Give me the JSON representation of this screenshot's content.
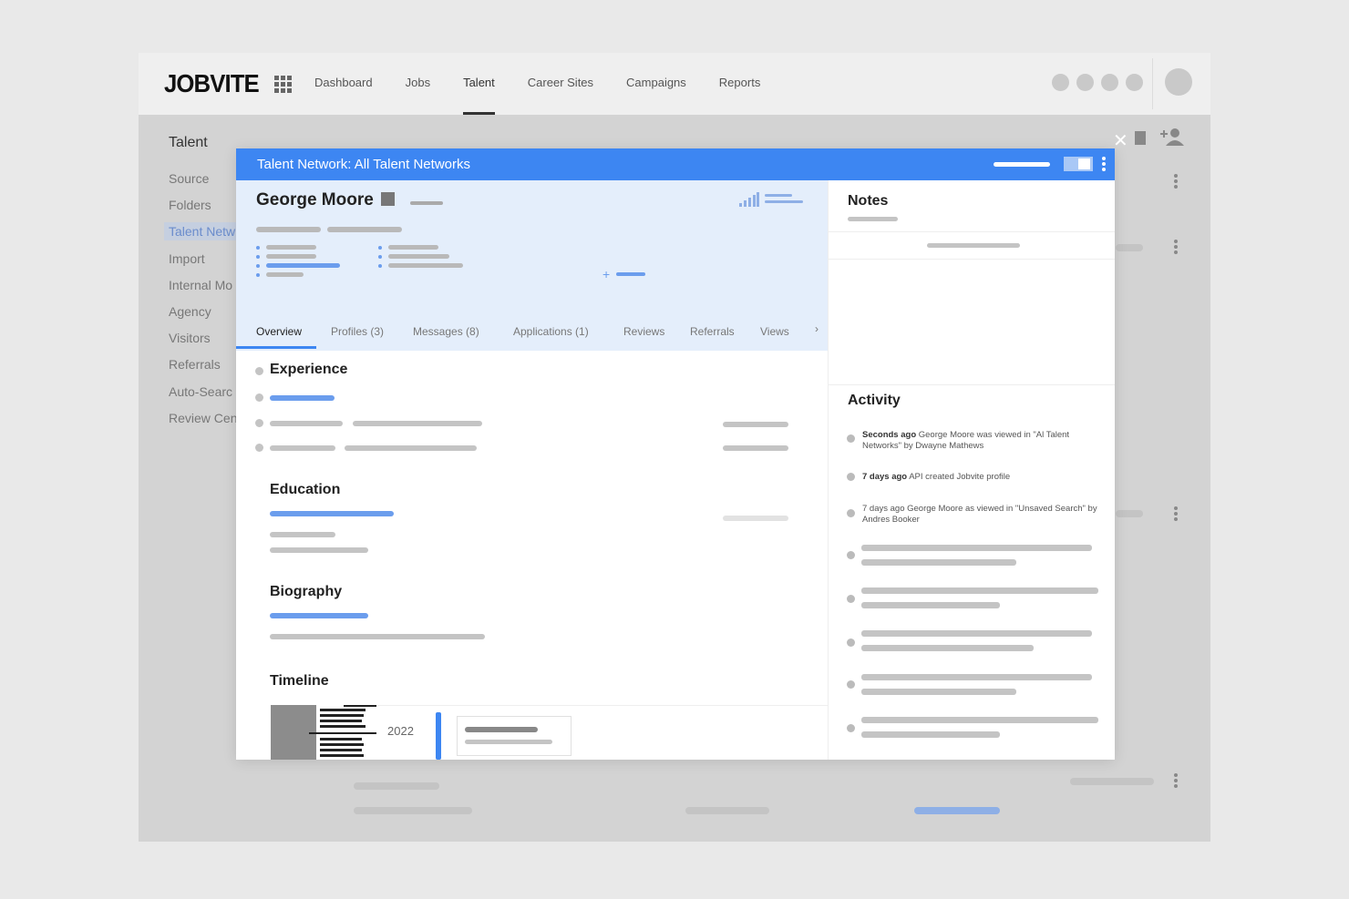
{
  "app": {
    "logo": "JOBVITE",
    "nav": [
      "Dashboard",
      "Jobs",
      "Talent",
      "Career Sites",
      "Campaigns",
      "Reports"
    ],
    "active_nav": "Talent"
  },
  "sidebar": {
    "title": "Talent",
    "items": [
      "Source",
      "Folders",
      "Talent Netw",
      "Import",
      "Internal Mo",
      "Agency",
      "Visitors",
      "Referrals",
      "Auto-Searc",
      "Review Cen"
    ],
    "active_item": "Talent Netw"
  },
  "modal": {
    "title": "Talent Network: All Talent Networks",
    "header_color": "#3d86f2",
    "candidate_name": "George Moore",
    "tabs": [
      "Overview",
      "Profiles (3)",
      "Messages (8)",
      "Applications (1)",
      "Reviews",
      "Referrals",
      "Views"
    ],
    "active_tab": "Overview",
    "sections": {
      "experience": "Experience",
      "education": "Education",
      "biography": "Biography",
      "timeline": "Timeline"
    },
    "timeline_year": "2022",
    "notes_title": "Notes",
    "activity_title": "Activity",
    "activity": [
      {
        "time": "Seconds ago",
        "text": " George Moore was viewed in \"Al Talent Networks\" by Dwayne Mathews"
      },
      {
        "time": "7 days ago",
        "text": " API created Jobvite profile"
      },
      {
        "time": "",
        "text": "7 days ago George Moore as viewed in \"Unsaved Search\" by Andres Booker"
      }
    ]
  }
}
